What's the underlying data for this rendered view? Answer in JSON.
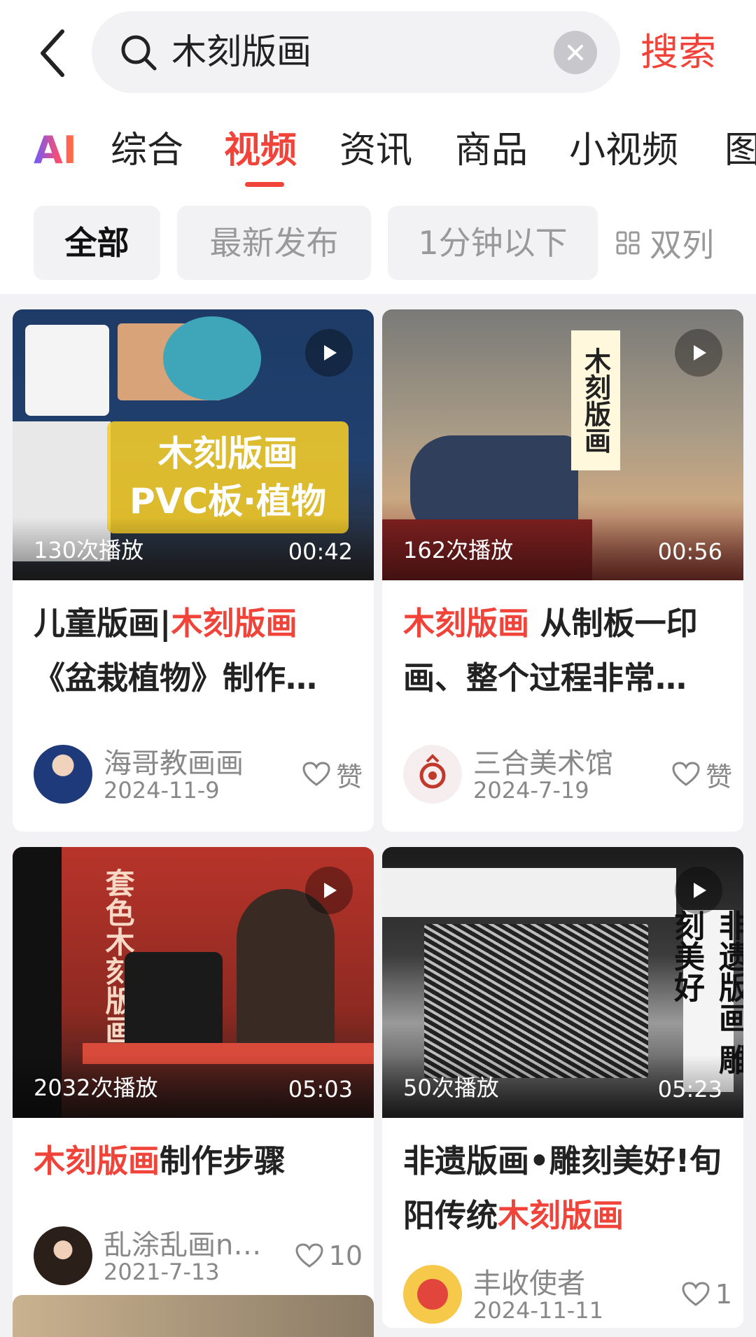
{
  "search": {
    "query": "木刻版画",
    "submit_label": "搜索"
  },
  "tabs": {
    "ai_label": "AI",
    "items": [
      "综合",
      "视频",
      "资讯",
      "商品",
      "小视频",
      "图"
    ],
    "active": "视频"
  },
  "filters": {
    "chips": [
      "全部",
      "最新发布",
      "1分钟以下"
    ],
    "active": "全部",
    "layout_label": "双列"
  },
  "videos": [
    {
      "thumb_text": "木刻版画\nPVC板·植物",
      "plays": "130次播放",
      "duration": "00:42",
      "title_parts": [
        "儿童版画|",
        "木刻版画",
        "《盆栽植物》制作…"
      ],
      "author": "海哥教画画",
      "date": "2024-11-9",
      "likes": "赞"
    },
    {
      "thumb_text": "木刻版画",
      "plays": "162次播放",
      "duration": "00:56",
      "title_parts": [
        "",
        "木刻版画",
        " 从制板一印画、整个过程非常…"
      ],
      "author": "三合美术馆",
      "date": "2024-7-19",
      "likes": "赞"
    },
    {
      "thumb_text": "套色木刻版画",
      "plays": "2032次播放",
      "duration": "05:03",
      "title_parts": [
        "",
        "木刻版画",
        "制作步骤"
      ],
      "author": "乱涂乱画nq…",
      "date": "2021-7-13",
      "likes": "10"
    },
    {
      "thumb_text": "非遗版画 雕刻美好",
      "plays": "50次播放",
      "duration": "05:23",
      "title_parts": [
        "非遗版画•雕刻美好!旬阳传统",
        "木刻版画",
        ""
      ],
      "author": "丰收使者",
      "date": "2024-11-11",
      "likes": "1"
    }
  ],
  "colors": {
    "accent": "#f0443a",
    "muted": "#888888"
  }
}
